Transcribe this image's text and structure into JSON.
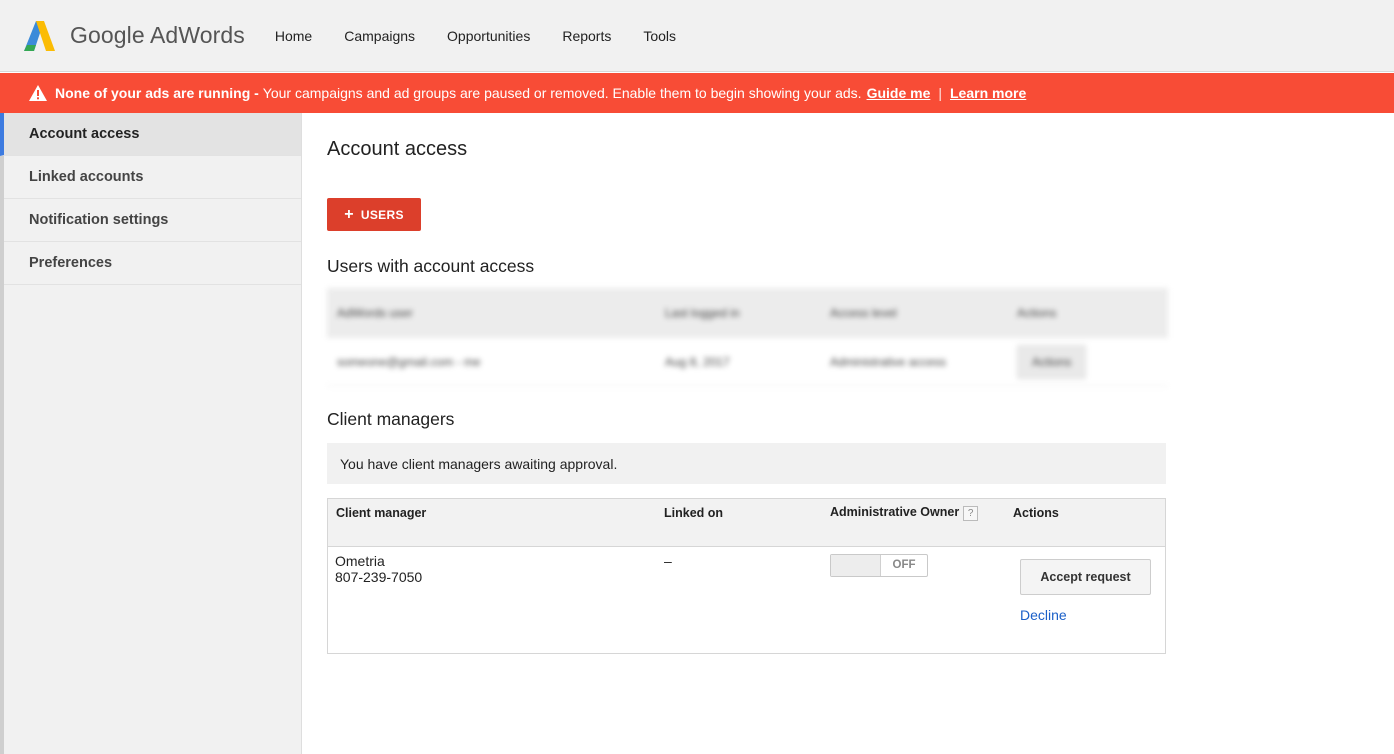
{
  "header": {
    "logo_text": "Google AdWords",
    "nav": [
      "Home",
      "Campaigns",
      "Opportunities",
      "Reports",
      "Tools"
    ]
  },
  "alert": {
    "bold_text": "None of your ads are running -",
    "message": "Your campaigns and ad groups are paused or removed. Enable them to begin showing your ads.",
    "guide_link": "Guide me",
    "separator": "|",
    "learn_link": "Learn more"
  },
  "sidebar": {
    "items": [
      {
        "label": "Account access",
        "active": true
      },
      {
        "label": "Linked accounts"
      },
      {
        "label": "Notification settings"
      },
      {
        "label": "Preferences"
      }
    ]
  },
  "main": {
    "title": "Account access",
    "add_users_label": "USERS",
    "users_section_title": "Users with account access",
    "users_table": {
      "columns": [
        "AdWords user",
        "Last logged in",
        "Access level",
        "Actions"
      ],
      "rows": [
        {
          "user": "someone@gmail.com - me",
          "last_login": "Aug 8, 2017",
          "access": "Administrative access",
          "action": "Actions"
        }
      ]
    },
    "client_managers_title": "Client managers",
    "awaiting_text": "You have client managers awaiting approval.",
    "cm_table": {
      "columns": [
        "Client manager",
        "Linked on",
        "Administrative Owner",
        "Actions"
      ],
      "help_glyph": "?",
      "rows": [
        {
          "name": "Ometria",
          "id": "807-239-7050",
          "linked_on": "–",
          "toggle_label": "OFF",
          "accept_label": "Accept request",
          "decline_label": "Decline"
        }
      ]
    }
  },
  "colors": {
    "alert_bg": "#f84c36",
    "primary_button": "#dc3f2b",
    "active_accent": "#3d7be0",
    "link": "#1a5fc8"
  }
}
